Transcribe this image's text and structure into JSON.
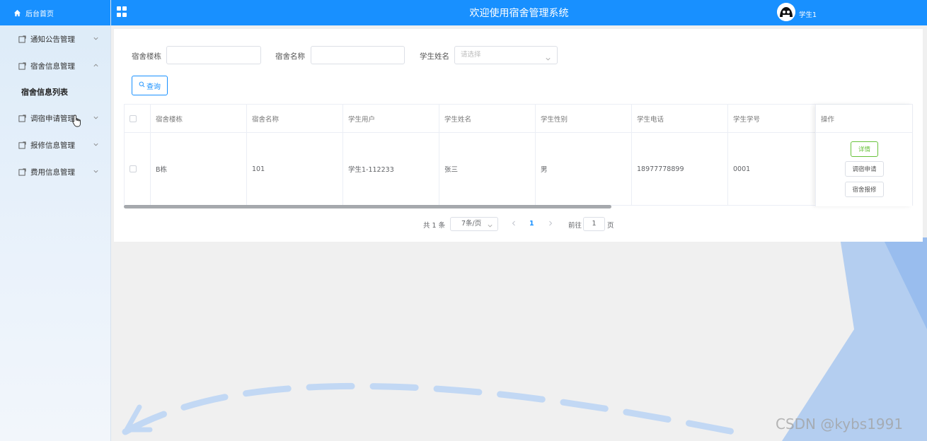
{
  "header": {
    "title": "欢迎使用宿舍管理系统",
    "username": "学生1",
    "accent_color": "#1890ff"
  },
  "sidebar": {
    "home": {
      "label": "后台首页",
      "icon": "home-icon"
    },
    "menus": [
      {
        "label": "通知公告管理",
        "icon": "menu-icon",
        "expanded": false
      },
      {
        "label": "宿舍信息管理",
        "icon": "menu-icon",
        "expanded": true,
        "children": [
          {
            "label": "宿舍信息列表",
            "active": true
          }
        ]
      },
      {
        "label": "调宿申请管理",
        "icon": "menu-icon",
        "expanded": false
      },
      {
        "label": "报修信息管理",
        "icon": "menu-icon",
        "expanded": false
      },
      {
        "label": "费用信息管理",
        "icon": "menu-icon",
        "expanded": false
      }
    ]
  },
  "search": {
    "building_label": "宿舍楼栋",
    "building_value": "",
    "room_label": "宿舍名称",
    "room_value": "",
    "student_label": "学生姓名",
    "student_placeholder": "请选择",
    "query_button": "查询"
  },
  "table": {
    "columns": [
      "宿舍楼栋",
      "宿舍名称",
      "学生用户",
      "学生姓名",
      "学生性别",
      "学生电话",
      "学生学号"
    ],
    "ops_header": "操作",
    "rows": [
      {
        "building": "B栋",
        "room": "101",
        "user": "学生1-112233",
        "name": "张三",
        "gender": "男",
        "phone": "18977778899",
        "student_no": "0001"
      }
    ],
    "row_actions": [
      "详情",
      "调宿申请",
      "宿舍报修"
    ]
  },
  "pagination": {
    "total_text": "共 1 条",
    "page_size": "7条/页",
    "current_page": "1",
    "goto_label": "前往",
    "goto_value": "1",
    "page_suffix": "页"
  },
  "watermark": "CSDN @kybs1991"
}
